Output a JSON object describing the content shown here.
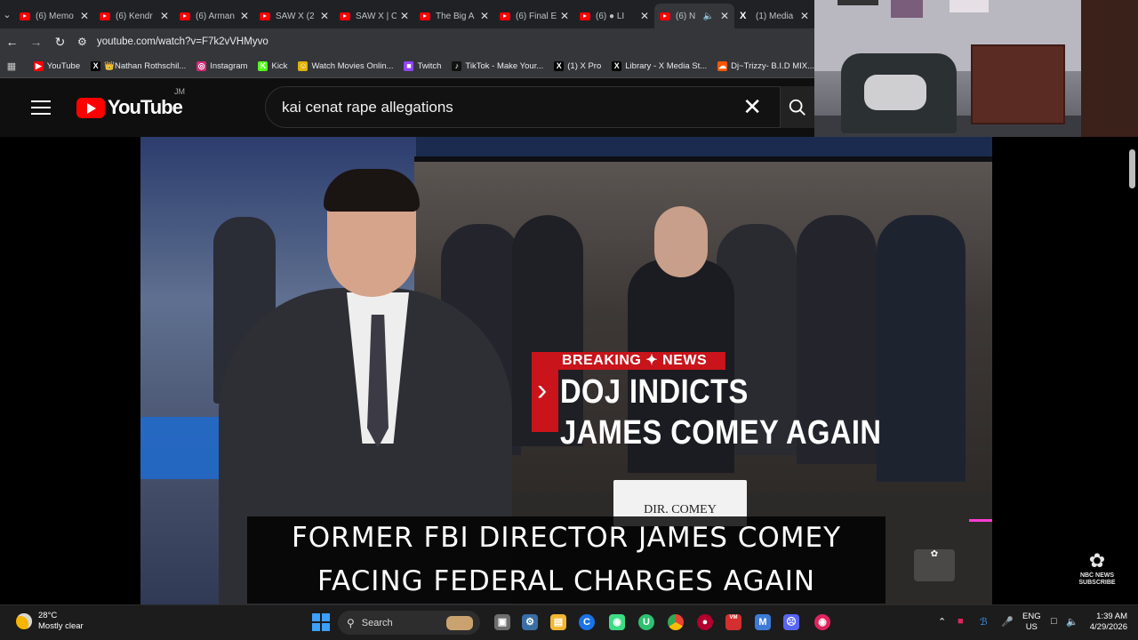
{
  "tabs": [
    {
      "label": "(6) Memo",
      "kind": "youtube"
    },
    {
      "label": "(6) Kendr",
      "kind": "youtube"
    },
    {
      "label": "(6) Arman",
      "kind": "youtube"
    },
    {
      "label": "SAW X (2",
      "kind": "youtube"
    },
    {
      "label": "SAW X | C",
      "kind": "youtube"
    },
    {
      "label": "The Big A",
      "kind": "youtube"
    },
    {
      "label": "(6) Final E",
      "kind": "youtube"
    },
    {
      "label": "(6) ● LI",
      "kind": "youtube"
    },
    {
      "label": "(6) N   🔈",
      "kind": "youtube",
      "active": true
    },
    {
      "label": "(1) Media",
      "kind": "x"
    }
  ],
  "address": {
    "url": "youtube.com/watch?v=F7k2vVHMyvo"
  },
  "bookmarks": [
    {
      "label": "YouTube",
      "color": "#ff0000",
      "glyph": "▶"
    },
    {
      "label": "👑Nathan Rothschil...",
      "color": "#000000",
      "glyph": "X"
    },
    {
      "label": "Instagram",
      "color": "#d62976",
      "glyph": "◎"
    },
    {
      "label": "Kick",
      "color": "#53fc18",
      "glyph": "K"
    },
    {
      "label": "Watch Movies Onlin...",
      "color": "#e0b400",
      "glyph": "☺"
    },
    {
      "label": "Twitch",
      "color": "#9146ff",
      "glyph": "■"
    },
    {
      "label": "TikTok - Make Your...",
      "color": "#111111",
      "glyph": "♪"
    },
    {
      "label": "(1) X Pro",
      "color": "#000000",
      "glyph": "X"
    },
    {
      "label": "Library - X Media St...",
      "color": "#000000",
      "glyph": "X"
    },
    {
      "label": "Dj~Trizzy- B.I.D MIX...",
      "color": "#ff5500",
      "glyph": "☁"
    }
  ],
  "youtube": {
    "logo_text": "YouTube",
    "country_code": "JM",
    "search_value": "kai cenat rape allegations"
  },
  "video": {
    "breaking": "BREAKING ✦ NEWS",
    "headline_line1": "DOJ INDICTS",
    "headline_line2": "JAMES COMEY AGAIN",
    "nameplate": "DIR. COMEY",
    "caption_line1": "FORMER FBI DIRECTOR JAMES COMEY",
    "caption_line2": "FACING FEDERAL CHARGES AGAIN",
    "watermark_line1": "NBC NEWS",
    "watermark_line2": "SUBSCRIBE"
  },
  "taskbar": {
    "temperature": "28°C",
    "weather": "Mostly clear",
    "search_label": "Search",
    "lang_line1": "ENG",
    "lang_line2": "US",
    "time": "1:39 AM",
    "date": "4/29/2026"
  },
  "colors": {
    "youtube_red": "#ff0000",
    "breaking_red": "#c8141a",
    "accent_blue": "#3ca0ff"
  }
}
